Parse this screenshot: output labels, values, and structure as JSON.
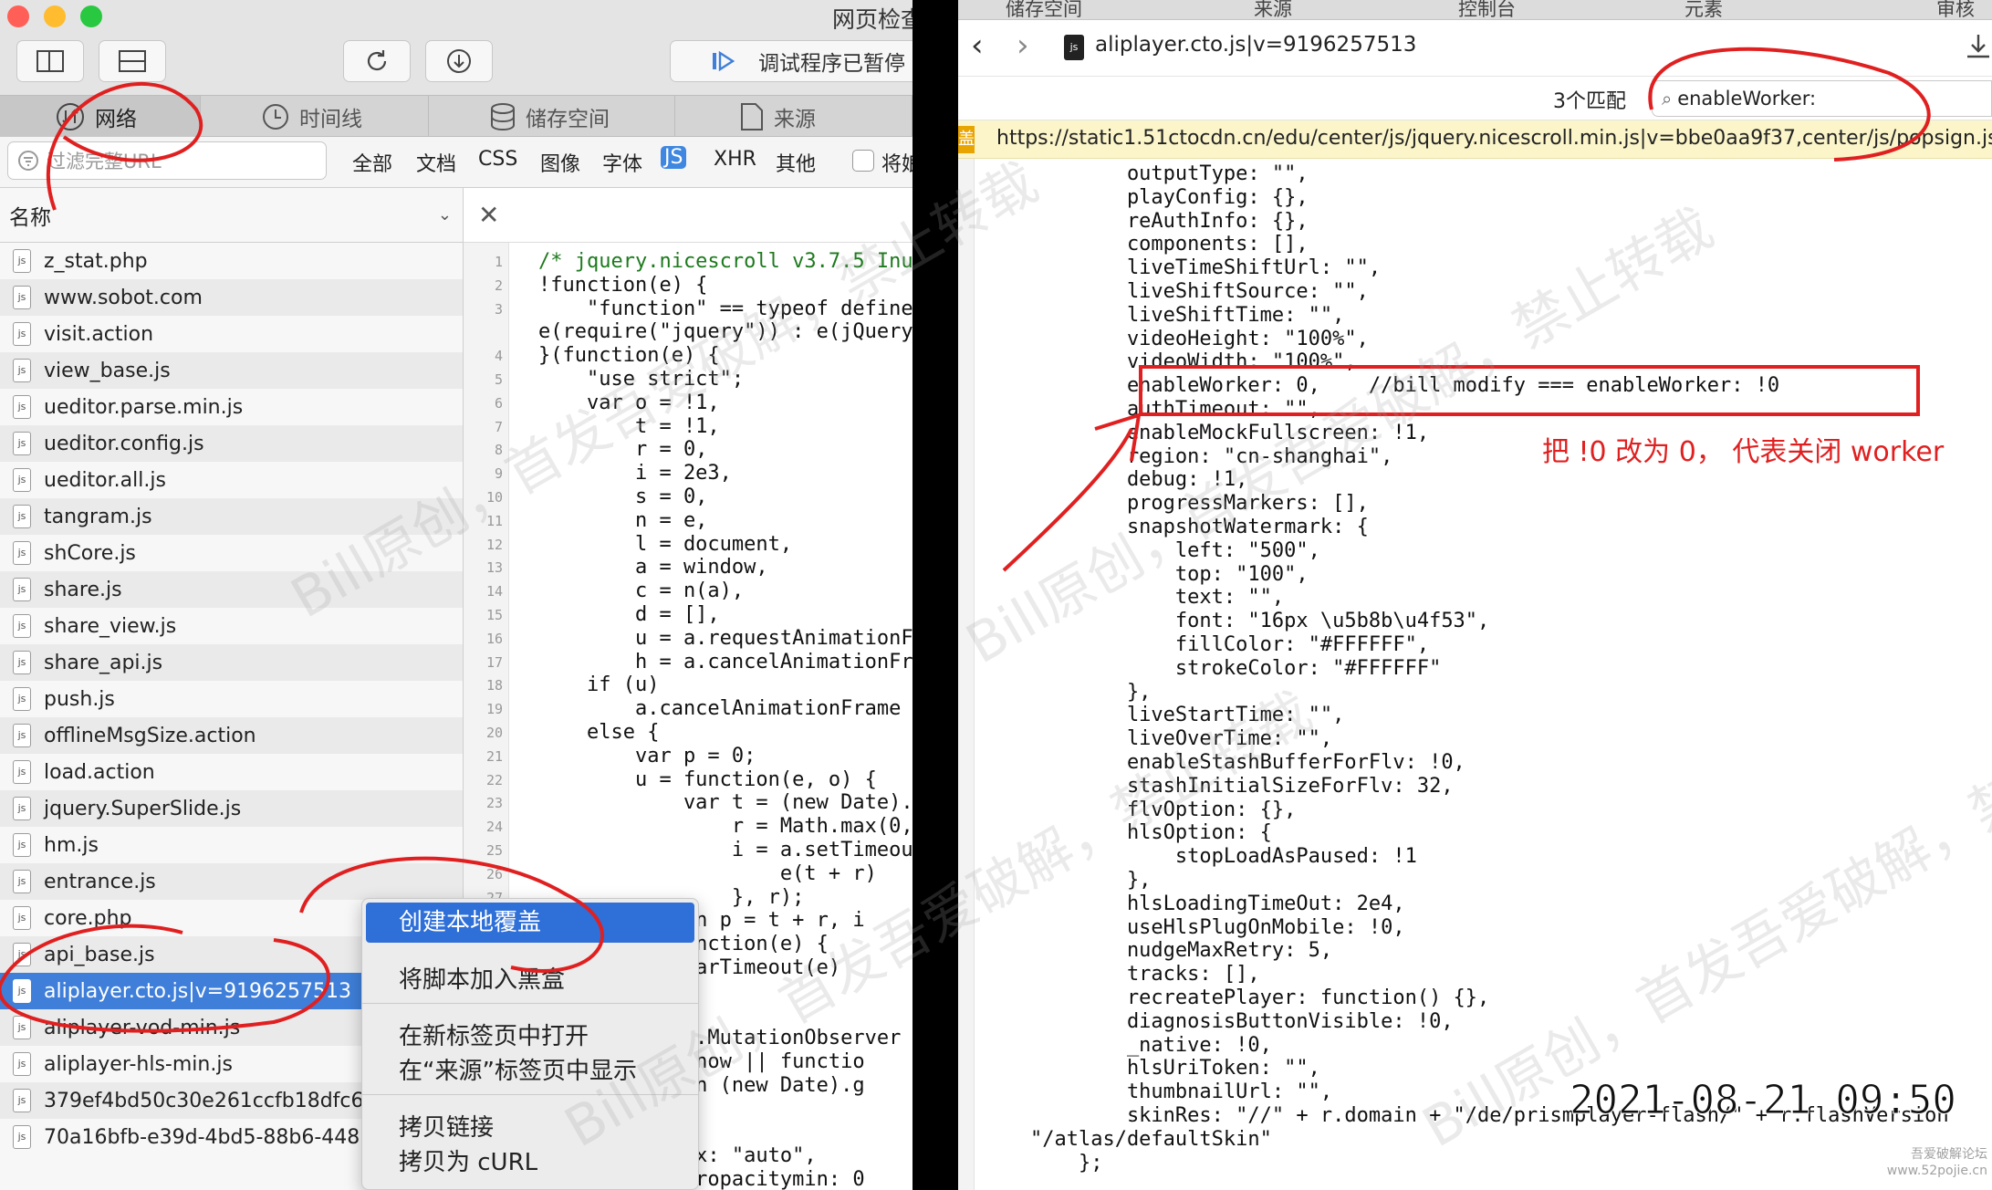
{
  "left_window": {
    "title": "网页检查",
    "toolbar": {
      "pause_label": "调试程序已暂停"
    },
    "tabs": [
      {
        "label": "网络"
      },
      {
        "label": "时间线"
      },
      {
        "label": "储存空间"
      },
      {
        "label": "来源"
      }
    ],
    "filter": {
      "placeholder": "过滤完整URL",
      "types": [
        "全部",
        "文档",
        "CSS",
        "图像",
        "字体",
        "JS",
        "XHR",
        "其他"
      ],
      "active_type": "JS",
      "checkbox_label": "将娘"
    },
    "sidebar": {
      "header": "名称",
      "items": [
        "z_stat.php",
        "www.sobot.com",
        "visit.action",
        "view_base.js",
        "ueditor.parse.min.js",
        "ueditor.config.js",
        "ueditor.all.js",
        "tangram.js",
        "shCore.js",
        "share.js",
        "share_view.js",
        "share_api.js",
        "push.js",
        "offlineMsgSize.action",
        "load.action",
        "jquery.SuperSlide.js",
        "hm.js",
        "entrance.js",
        "core.php",
        "api_base.js",
        "aliplayer.cto.js|v=9196257513",
        "aliplayer-vod-min.js",
        "aliplayer-hls-min.js",
        "379ef4bd50c30e261ccfb18dfc62",
        "70a16bfb-e39d-4bd5-88b6-448"
      ],
      "selected": "aliplayer.cto.js|v=9196257513"
    },
    "editor_lines": [
      {
        "n": "1",
        "t": "/* jquery.nicescroll v3.7.5 Inu"
      },
      {
        "n": "2",
        "t": "!function(e) {"
      },
      {
        "n": "3",
        "t": "    \"function\" == typeof define"
      },
      {
        "n": "",
        "t": "e(require(\"jquery\")) : e(jQuery"
      },
      {
        "n": "4",
        "t": "}(function(e) {"
      },
      {
        "n": "5",
        "t": "    \"use strict\";"
      },
      {
        "n": "6",
        "t": "    var o = !1,"
      },
      {
        "n": "7",
        "t": "        t = !1,"
      },
      {
        "n": "8",
        "t": "        r = 0,"
      },
      {
        "n": "9",
        "t": "        i = 2e3,"
      },
      {
        "n": "10",
        "t": "        s = 0,"
      },
      {
        "n": "11",
        "t": "        n = e,"
      },
      {
        "n": "12",
        "t": "        l = document,"
      },
      {
        "n": "13",
        "t": "        a = window,"
      },
      {
        "n": "14",
        "t": "        c = n(a),"
      },
      {
        "n": "15",
        "t": "        d = [],"
      },
      {
        "n": "16",
        "t": "        u = a.requestAnimationF"
      },
      {
        "n": "17",
        "t": "        h = a.cancelAnimationFr"
      },
      {
        "n": "18",
        "t": "    if (u)"
      },
      {
        "n": "19",
        "t": "        a.cancelAnimationFrame"
      },
      {
        "n": "20",
        "t": "    else {"
      },
      {
        "n": "21",
        "t": "        var p = 0;"
      },
      {
        "n": "22",
        "t": "        u = function(e, o) {"
      },
      {
        "n": "23",
        "t": "            var t = (new Date)."
      },
      {
        "n": "24",
        "t": "                r = Math.max(0,"
      },
      {
        "n": "25",
        "t": "                i = a.setTimeou"
      },
      {
        "n": "26",
        "t": "                    e(t + r)"
      },
      {
        "n": "27",
        "t": "                }, r);"
      },
      {
        "n": "",
        "t": "        return p = t + r, i"
      },
      {
        "n": "",
        "t": "    }, h = function(e) {"
      },
      {
        "n": "",
        "t": "        a.clearTimeout(e)"
      },
      {
        "n": "",
        "t": ""
      },
      {
        "n": "",
        "t": "    }"
      },
      {
        "n": "",
        "t": "    var f = a.MutationObserver"
      },
      {
        "n": "",
        "t": "    m = Date.now || functio"
      },
      {
        "n": "",
        "t": "        return (new Date).g"
      },
      {
        "n": "",
        "t": ""
      },
      {
        "n": "",
        "t": "        ..."
      },
      {
        "n": "",
        "t": "        zindex: \"auto\","
      },
      {
        "n": "",
        "t": "        cursoropacitymin: 0"
      }
    ],
    "context_menu": [
      {
        "label": "创建本地覆盖"
      },
      {
        "label": "将脚本加入黑盒"
      },
      {
        "label": "在新标签页中打开"
      },
      {
        "label": "在“来源”标签页中显示"
      },
      {
        "label": "拷贝链接"
      },
      {
        "label": "拷贝为 cURL"
      }
    ]
  },
  "right_window": {
    "top_tabs": [
      "储存空间",
      "来源",
      "控制台",
      "元素",
      "审核"
    ],
    "file_title": "aliplayer.cto.js|v=9196257513",
    "match_count": "3个匹配",
    "search_value": "enableWorker:",
    "url_badge": "盖",
    "url": "https://static1.51ctocdn.cn/edu/center/js/jquery.nicescroll.min.js|v=bbe0aa9f37,center/js/popsign.js|v=1c",
    "annotation_text": "把 !0 改为 0， 代表关闭 worker",
    "timestamp": "2021-08-21 09:50",
    "watermark": "Bill原创，首发吾爱破解，禁止转载",
    "footer_logo": "吾爱破解论坛 www.52pojie.cn",
    "code_lines": [
      "            outputType: \"\",",
      "            playConfig: {},",
      "            reAuthInfo: {},",
      "            components: [],",
      "            liveTimeShiftUrl: \"\",",
      "            liveShiftSource: \"\",",
      "            liveShiftTime: \"\",",
      "            videoHeight: \"100%\",",
      "            videoWidth: \"100%\",",
      "            enableWorker: 0,    //bill modify === enableWorker: !0",
      "            authTimeout: \"\",",
      "            enableMockFullscreen: !1,",
      "            region: \"cn-shanghai\",",
      "            debug: !1,",
      "            progressMarkers: [],",
      "            snapshotWatermark: {",
      "                left: \"500\",",
      "                top: \"100\",",
      "                text: \"\",",
      "                font: \"16px \\u5b8b\\u4f53\",",
      "                fillColor: \"#FFFFFF\",",
      "                strokeColor: \"#FFFFFF\"",
      "            },",
      "            liveStartTime: \"\",",
      "            liveOverTime: \"\",",
      "            enableStashBufferForFlv: !0,",
      "            stashInitialSizeForFlv: 32,",
      "            flvOption: {},",
      "            hlsOption: {",
      "                stopLoadAsPaused: !1",
      "            },",
      "            hlsLoadingTimeOut: 2e4,",
      "            useHlsPlugOnMobile: !0,",
      "            nudgeMaxRetry: 5,",
      "            tracks: [],",
      "            recreatePlayer: function() {},",
      "            diagnosisButtonVisible: !0,",
      "            _native: !0,",
      "            hlsUriToken: \"\",",
      "            thumbnailUrl: \"\",",
      "            skinRes: \"//\" + r.domain + \"/de/prismplayer-flash/\" + r.flashVersion",
      "    \"/atlas/defaultSkin\"",
      "        };"
    ]
  },
  "colors": {
    "accent": "#3f7fd9",
    "annotation": "#e02020"
  }
}
